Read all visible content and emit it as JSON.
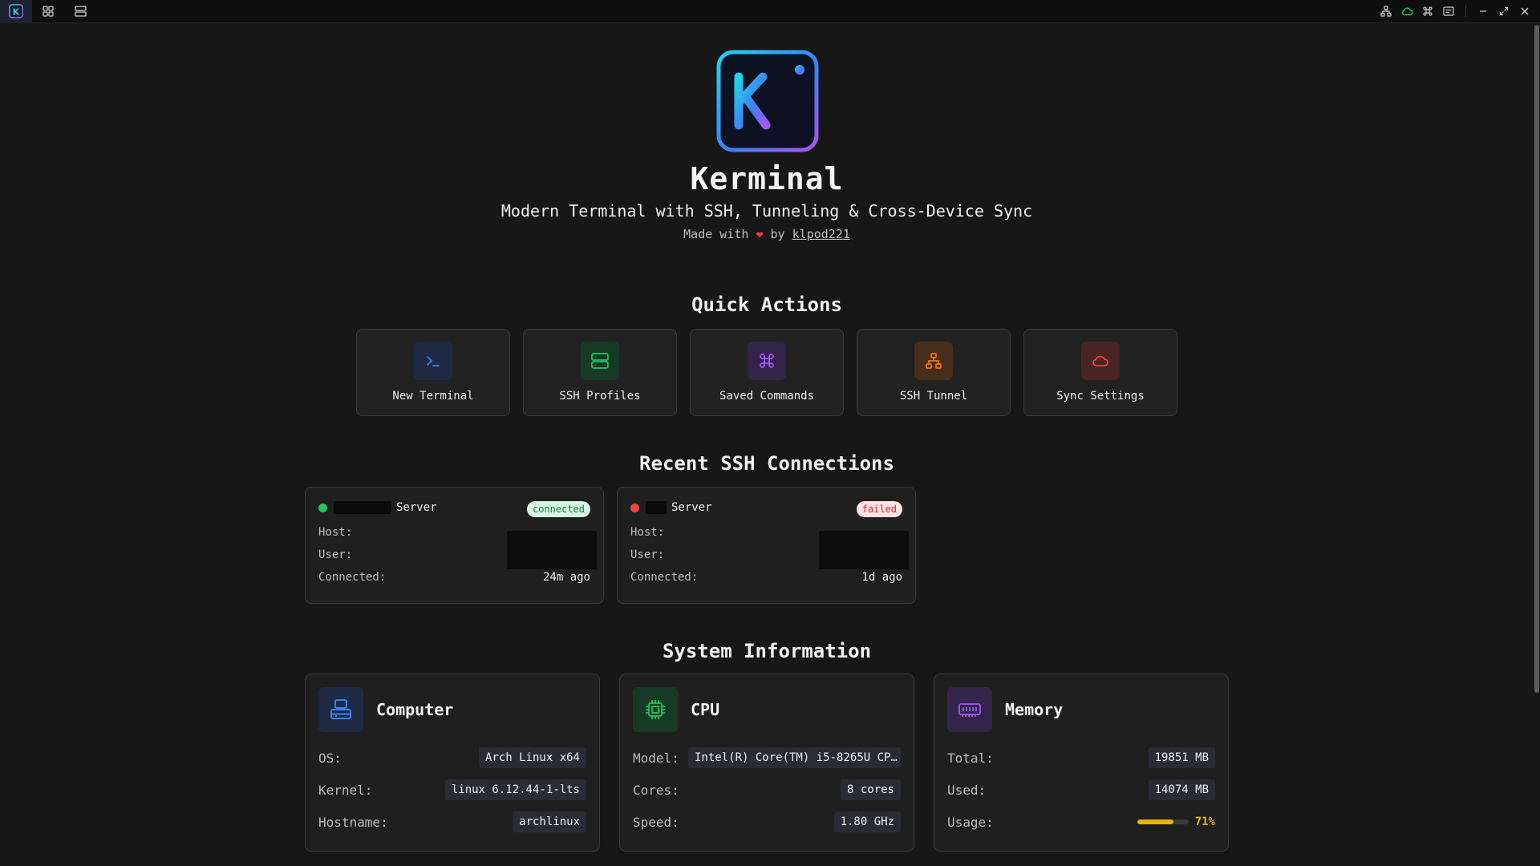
{
  "window": {
    "app_icon_letter": "K"
  },
  "hero": {
    "title": "Kerminal",
    "subtitle": "Modern Terminal with SSH, Tunneling & Cross-Device Sync",
    "made_with_prefix": "Made with",
    "made_with_by": "by",
    "author": "klpod221"
  },
  "quick_actions": {
    "title": "Quick Actions",
    "items": [
      {
        "label": "New Terminal",
        "icon": "terminal-icon",
        "color": "#3b82f6",
        "bg": "#1e2a44"
      },
      {
        "label": "SSH Profiles",
        "icon": "server-icon",
        "color": "#22c55e",
        "bg": "#163a26"
      },
      {
        "label": "Saved Commands",
        "icon": "command-icon",
        "color": "#a855f7",
        "bg": "#33244a"
      },
      {
        "label": "SSH Tunnel",
        "icon": "network-icon",
        "color": "#f97316",
        "bg": "#472d1c"
      },
      {
        "label": "Sync Settings",
        "icon": "cloud-icon",
        "color": "#ef4444",
        "bg": "#4a2325"
      }
    ]
  },
  "recent": {
    "title": "Recent SSH Connections",
    "connections": [
      {
        "name": "Server",
        "status": "connected",
        "status_color": "#22c55e",
        "host_label": "Host:",
        "user_label": "User:",
        "connected_label": "Connected:",
        "connected_value": "24m ago"
      },
      {
        "name": "Server",
        "status": "failed",
        "status_color": "#ef4444",
        "host_label": "Host:",
        "user_label": "User:",
        "connected_label": "Connected:",
        "connected_value": "1d ago"
      }
    ]
  },
  "system": {
    "title": "System Information",
    "computer": {
      "title": "Computer",
      "icon": "computer-icon",
      "os_label": "OS:",
      "os": "Arch Linux x64",
      "kernel_label": "Kernel:",
      "kernel": "linux 6.12.44-1-lts",
      "hostname_label": "Hostname:",
      "hostname": "archlinux"
    },
    "cpu": {
      "title": "CPU",
      "icon": "cpu-icon",
      "model_label": "Model:",
      "model": "Intel(R) Core(TM) i5-8265U CP…",
      "cores_label": "Cores:",
      "cores": "8 cores",
      "speed_label": "Speed:",
      "speed": "1.80 GHz"
    },
    "memory": {
      "title": "Memory",
      "icon": "memory-icon",
      "total_label": "Total:",
      "total": "19851 MB",
      "used_label": "Used:",
      "used": "14074 MB",
      "usage_label": "Usage:",
      "usage_pct": "71%",
      "usage_fraction": 0.71
    }
  }
}
